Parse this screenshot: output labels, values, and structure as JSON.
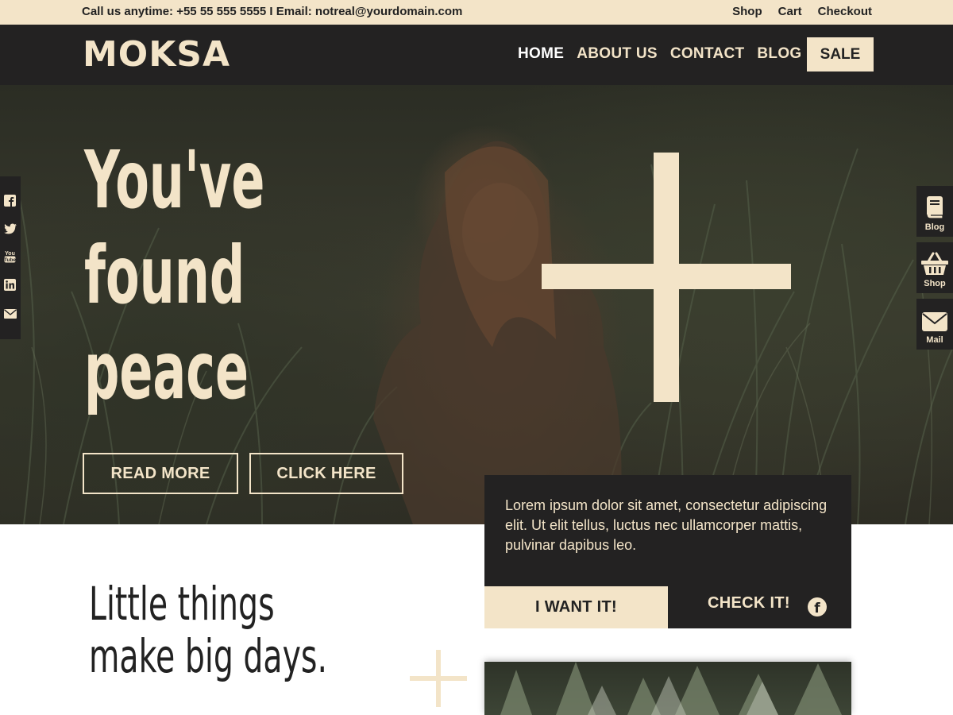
{
  "topbar": {
    "contact_text": "Call us anytime: +55 55 555 5555 I Email: notreal@yourdomain.com",
    "links": [
      "Shop",
      "Cart",
      "Checkout"
    ]
  },
  "header": {
    "logo": "MOKSA",
    "nav": [
      "HOME",
      "ABOUT US",
      "CONTACT",
      "BLOG"
    ],
    "sale_label": "SALE"
  },
  "hero": {
    "title_lines": [
      "You've",
      "found",
      "peace"
    ],
    "read_more_label": "READ MORE",
    "click_here_label": "CLICK HERE"
  },
  "social": {
    "icons": [
      "facebook-icon",
      "twitter-icon",
      "youtube-icon",
      "linkedin-icon",
      "mail-icon"
    ]
  },
  "side_widgets": {
    "blog_label": "Blog",
    "shop_label": "Shop",
    "mail_label": "Mail"
  },
  "card": {
    "text": "Lorem ipsum dolor sit amet, consectetur adipiscing elit. Ut elit tellus, luctus nec ullamcorper mattis, pulvinar dapibus leo.",
    "want_label": "I WANT IT!",
    "check_label": "CHECK IT!",
    "facebook_glyph": "f"
  },
  "lower": {
    "tagline_lines": [
      "Little things",
      "make big days."
    ]
  },
  "colors": {
    "cream": "#f3e4c8",
    "dark": "#232222"
  }
}
